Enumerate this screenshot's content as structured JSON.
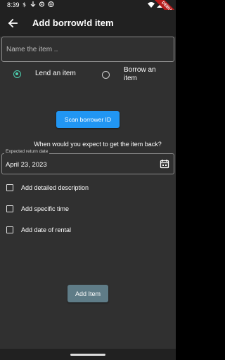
{
  "status_bar": {
    "time": "8:39",
    "debug_label": "DEBUG"
  },
  "app_bar": {
    "title": "Add borrow!d item"
  },
  "name_field": {
    "placeholder": "Name the item .."
  },
  "radios": [
    {
      "label": "Lend an item",
      "selected": true
    },
    {
      "label": "Borrow an item",
      "selected": false
    }
  ],
  "scan_button": {
    "label": "Scan borrower ID"
  },
  "return_question": "When would you expect to get the item back?",
  "date_field": {
    "label": "Expected return date",
    "value": "April 23, 2023"
  },
  "checkboxes": [
    {
      "label": "Add detailed description",
      "checked": false
    },
    {
      "label": "Add specific time",
      "checked": false
    },
    {
      "label": "Add date of rental",
      "checked": false
    }
  ],
  "add_button": {
    "label": "Add Item"
  },
  "colors": {
    "background": "#303030",
    "app_bar": "#212121",
    "accent_radio": "#4dd0b0",
    "scan_button": "#2196f3",
    "add_button": "#5f7c87"
  }
}
